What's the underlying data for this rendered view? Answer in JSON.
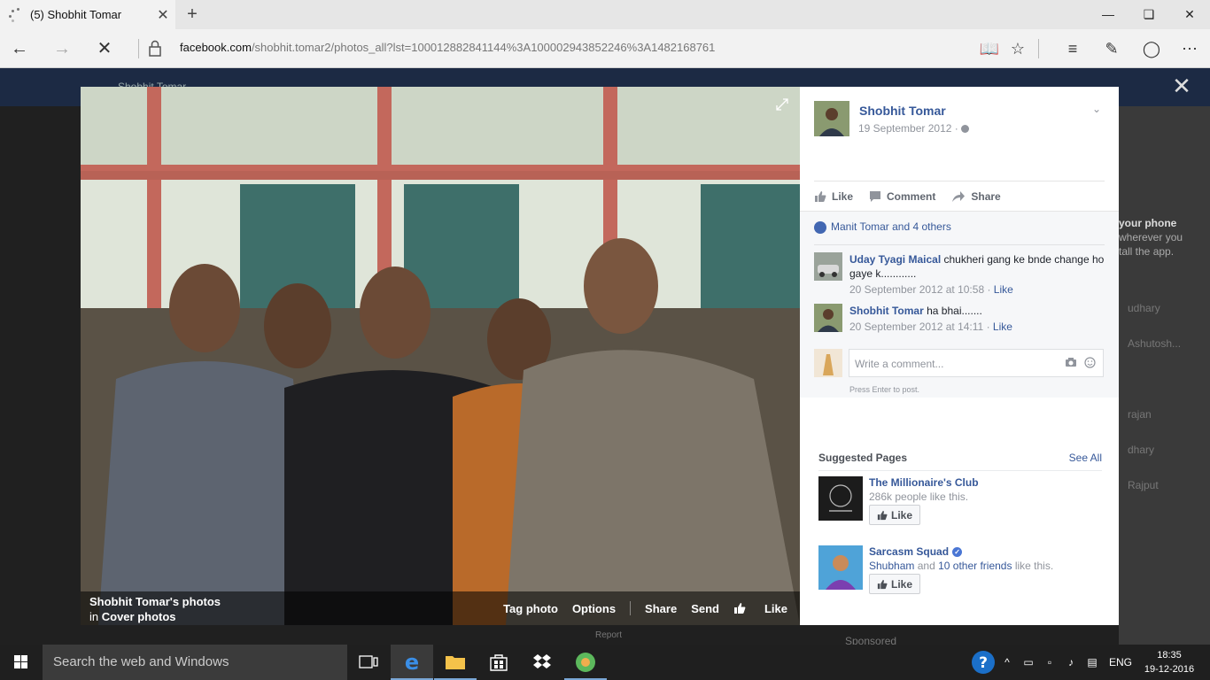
{
  "browser": {
    "tab_title": "(5) Shobhit Tomar",
    "url_domain": "facebook.com",
    "url_path": "/shobhit.tomar2/photos_all?lst=100012882841144%3A100002943852246%3A1482168761"
  },
  "background": {
    "search_text": "Shobhit Tomar",
    "your_phone_text": "your phone",
    "wherever_text": "wherever you",
    "install_text": "tall the app.",
    "names": [
      "udhary",
      "Ashutosh...",
      "rajan",
      "dhary",
      "Rajput"
    ],
    "sponsored": "Sponsored",
    "report": "Report"
  },
  "photo": {
    "owner_photos": "Shobhit Tomar's photos",
    "in_label": "in",
    "album": "Cover photos",
    "actions": [
      "Tag photo",
      "Options",
      "Share",
      "Send",
      "Like"
    ]
  },
  "post": {
    "author": "Shobhit Tomar",
    "date": "19 September 2012",
    "actions": [
      "Like",
      "Comment",
      "Share"
    ],
    "likes": "Manit Tomar and 4 others",
    "comments": [
      {
        "name": "Uday Tyagi Maical",
        "text": "chukheri gang ke bnde change ho gaye k............",
        "time": "20 September 2012 at 10:58",
        "like": "Like"
      },
      {
        "name": "Shobhit Tomar",
        "text": "ha bhai.......",
        "time": "20 September 2012 at 14:11",
        "like": "Like"
      }
    ],
    "write_placeholder": "Write a comment...",
    "press_enter": "Press Enter to post."
  },
  "suggested": {
    "title": "Suggested Pages",
    "see_all": "See All",
    "pages": [
      {
        "name": "The Millionaire's Club",
        "sub": "286k people like this.",
        "like": "Like"
      },
      {
        "name": "Sarcasm Squad",
        "friend": "Shubham",
        "and": "and",
        "others": "10 other friends",
        "suffix": "like this.",
        "like": "Like"
      }
    ]
  },
  "taskbar": {
    "search_placeholder": "Search the web and Windows",
    "language": "ENG",
    "time": "18:35",
    "date": "19-12-2016"
  }
}
